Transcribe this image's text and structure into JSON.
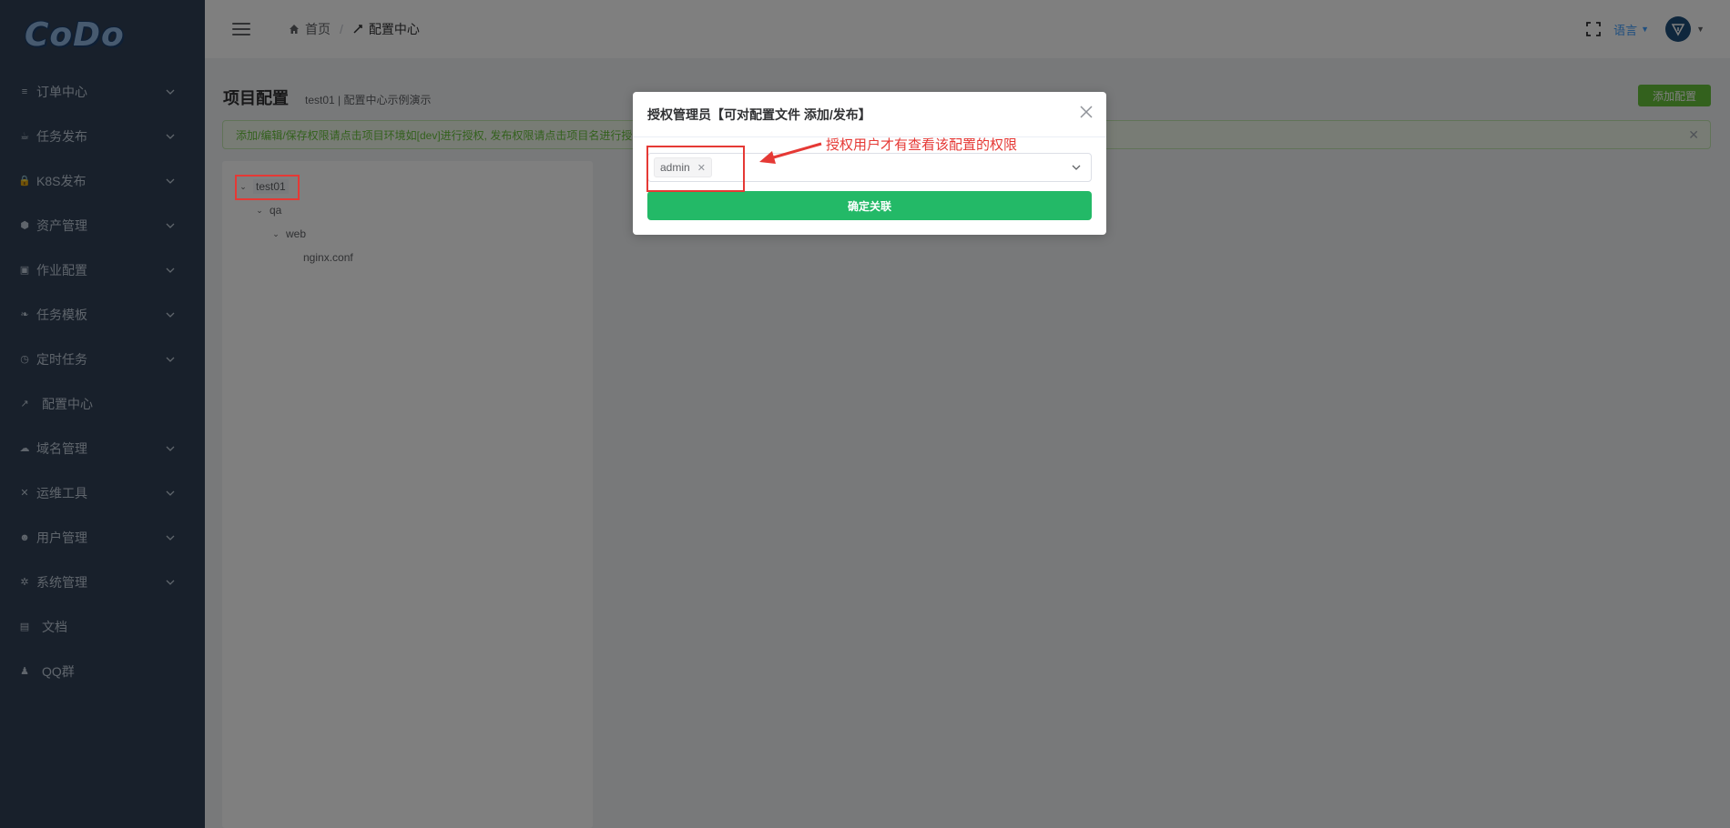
{
  "sidebar": {
    "logo": "CoDo",
    "items": [
      {
        "label": "订单中心",
        "icon": "list-icon",
        "has_sub": true
      },
      {
        "label": "任务发布",
        "icon": "cup-icon",
        "has_sub": true
      },
      {
        "label": "K8S发布",
        "icon": "lock-icon",
        "has_sub": true
      },
      {
        "label": "资产管理",
        "icon": "cube-icon",
        "has_sub": true
      },
      {
        "label": "作业配置",
        "icon": "briefcase-icon",
        "has_sub": true
      },
      {
        "label": "任务模板",
        "icon": "leaf-icon",
        "has_sub": true
      },
      {
        "label": "定时任务",
        "icon": "clock-icon",
        "has_sub": true
      },
      {
        "label": "配置中心",
        "icon": "pencil-icon",
        "has_sub": false
      },
      {
        "label": "域名管理",
        "icon": "cloud-icon",
        "has_sub": true
      },
      {
        "label": "运维工具",
        "icon": "tools-icon",
        "has_sub": true
      },
      {
        "label": "用户管理",
        "icon": "users-icon",
        "has_sub": true
      },
      {
        "label": "系统管理",
        "icon": "gear-icon",
        "has_sub": true
      },
      {
        "label": "文档",
        "icon": "book-icon",
        "has_sub": false
      },
      {
        "label": "QQ群",
        "icon": "qq-icon",
        "has_sub": false
      }
    ]
  },
  "header": {
    "breadcrumb_home": "首页",
    "breadcrumb_current": "配置中心",
    "language": "语言"
  },
  "main": {
    "title": "项目配置",
    "subtitle": "test01 | 配置中心示例演示",
    "add_button": "添加配置",
    "alert": "添加/编辑/保存权限请点击项目环境如[dev]进行授权, 发布权限请点击项目名进行授",
    "tree": [
      {
        "label": "test01",
        "expanded": true
      },
      {
        "label": "qa",
        "expanded": true
      },
      {
        "label": "web",
        "expanded": true
      },
      {
        "label": "nginx.conf",
        "expanded": false
      }
    ]
  },
  "dialog": {
    "title": "授权管理员【可对配置文件 添加/发布】",
    "selected_tag": "admin",
    "confirm_button": "确定关联"
  },
  "annotation": {
    "text": "授权用户才有查看该配置的权限"
  },
  "colors": {
    "sidebar_bg": "#304156",
    "accent_green": "#23b967",
    "annotation_red": "#e53935"
  }
}
